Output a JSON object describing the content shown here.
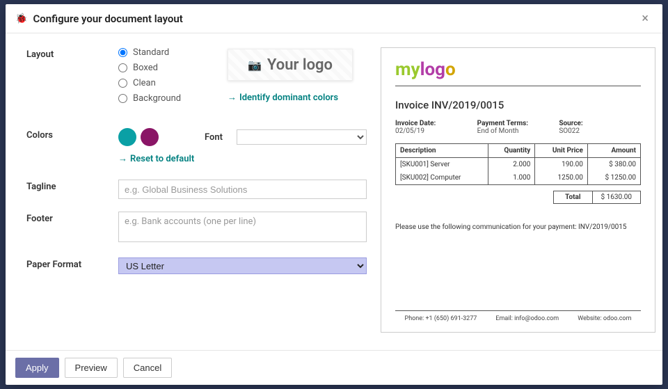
{
  "modal": {
    "title": "Configure your document layout"
  },
  "form": {
    "layout_label": "Layout",
    "layout_options": [
      "Standard",
      "Boxed",
      "Clean",
      "Background"
    ],
    "layout_selected": "Standard",
    "logo_placeholder": "Your logo",
    "identify_colors": "Identify dominant colors",
    "colors_label": "Colors",
    "color_swatches": [
      "#0aa0a5",
      "#8a1566"
    ],
    "reset_default": "Reset to default",
    "font_label": "Font",
    "tagline_label": "Tagline",
    "tagline_placeholder": "e.g. Global Business Solutions",
    "footer_label": "Footer",
    "footer_placeholder": "e.g. Bank accounts (one per line)",
    "paper_label": "Paper Format",
    "paper_value": "US Letter"
  },
  "preview": {
    "logo_text": "mylogo",
    "title": "Invoice INV/2019/0015",
    "meta": {
      "date_label": "Invoice Date:",
      "date_value": "02/05/19",
      "terms_label": "Payment Terms:",
      "terms_value": "End of Month",
      "source_label": "Source:",
      "source_value": "SO022"
    },
    "columns": [
      "Description",
      "Quantity",
      "Unit Price",
      "Amount"
    ],
    "lines": [
      {
        "desc": "[SKU001] Server",
        "qty": "2.000",
        "price": "190.00",
        "amount": "$ 380.00"
      },
      {
        "desc": "[SKU002] Computer",
        "qty": "1.000",
        "price": "1250.00",
        "amount": "$ 1250.00"
      }
    ],
    "total_label": "Total",
    "total_value": "$ 1630.00",
    "note": "Please use the following communication for your payment: INV/2019/0015",
    "footer_phone": "Phone: +1 (650) 691-3277",
    "footer_email": "Email: info@odoo.com",
    "footer_site": "Website: odoo.com"
  },
  "actions": {
    "apply": "Apply",
    "preview": "Preview",
    "cancel": "Cancel"
  }
}
